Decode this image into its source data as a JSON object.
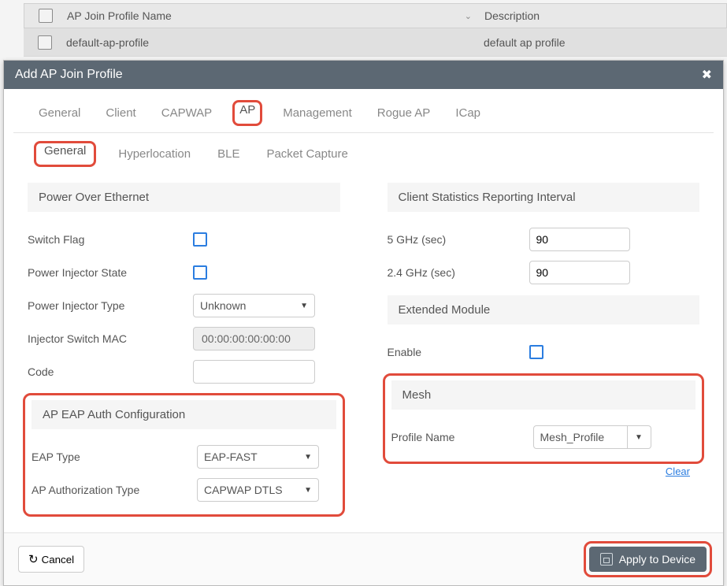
{
  "background_table": {
    "columns": {
      "name": "AP Join Profile Name",
      "desc": "Description"
    },
    "rows": [
      {
        "name": "default-ap-profile",
        "desc": "default ap profile"
      }
    ]
  },
  "modal": {
    "title": "Add AP Join Profile",
    "tabs_main": [
      "General",
      "Client",
      "CAPWAP",
      "AP",
      "Management",
      "Rogue AP",
      "ICap"
    ],
    "active_main": "AP",
    "tabs_sub": [
      "General",
      "Hyperlocation",
      "BLE",
      "Packet Capture"
    ],
    "active_sub": "General",
    "left": {
      "poe_header": "Power Over Ethernet",
      "switch_flag_label": "Switch Flag",
      "power_injector_state_label": "Power Injector State",
      "power_injector_type_label": "Power Injector Type",
      "power_injector_type_value": "Unknown",
      "injector_mac_label": "Injector Switch MAC",
      "injector_mac_value": "00:00:00:00:00:00",
      "code_label": "Code",
      "code_value": "",
      "eap_header": "AP EAP Auth Configuration",
      "eap_type_label": "EAP Type",
      "eap_type_value": "EAP-FAST",
      "auth_type_label": "AP Authorization Type",
      "auth_type_value": "CAPWAP DTLS"
    },
    "right": {
      "stats_header": "Client Statistics Reporting Interval",
      "ghz5_label": "5 GHz (sec)",
      "ghz5_value": "90",
      "ghz24_label": "2.4 GHz (sec)",
      "ghz24_value": "90",
      "ext_header": "Extended Module",
      "enable_label": "Enable",
      "mesh_header": "Mesh",
      "profile_label": "Profile Name",
      "profile_value": "Mesh_Profile",
      "clear_link": "Clear"
    },
    "footer": {
      "cancel": "Cancel",
      "apply": "Apply to Device"
    }
  }
}
